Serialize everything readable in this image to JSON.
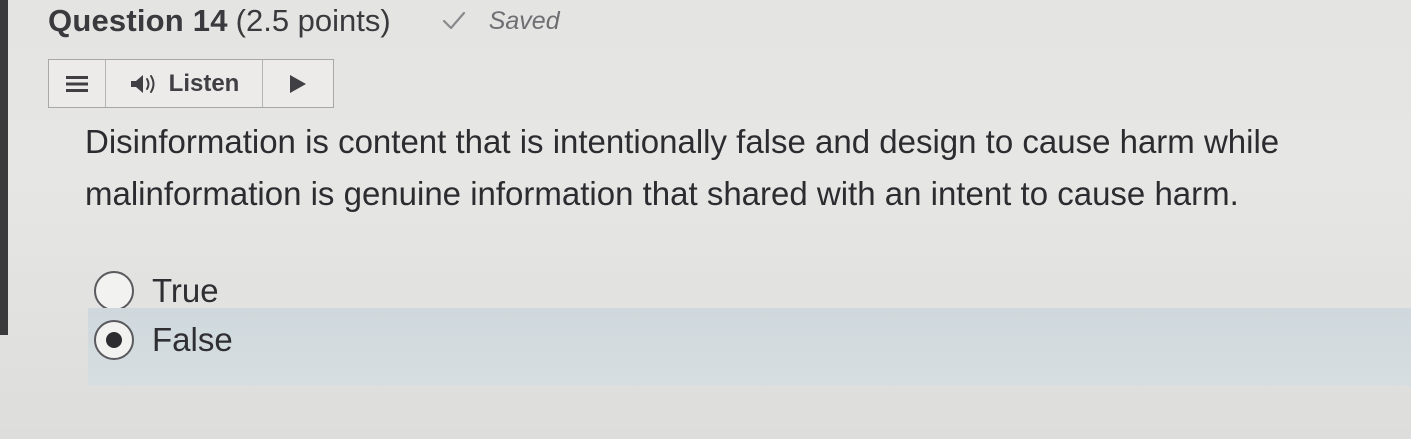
{
  "question": {
    "title": "Question 14",
    "points": "(2.5 points)",
    "saved_status": "Saved",
    "text": "Disinformation is content that is intentionally false and design to cause harm while malinformation is genuine information that shared with an intent to cause harm."
  },
  "listen_toolbar": {
    "menu_icon": "hamburger-menu-icon",
    "speaker_icon": "speaker-icon",
    "listen_label": "Listen",
    "play_icon": "play-icon"
  },
  "options": [
    {
      "label": "True",
      "selected": false
    },
    {
      "label": "False",
      "selected": true
    }
  ],
  "colors": {
    "background": "#e4e4e2",
    "selected_row": "#d2dadd",
    "text": "#2c2c30",
    "saved_text": "#6e6e73"
  }
}
